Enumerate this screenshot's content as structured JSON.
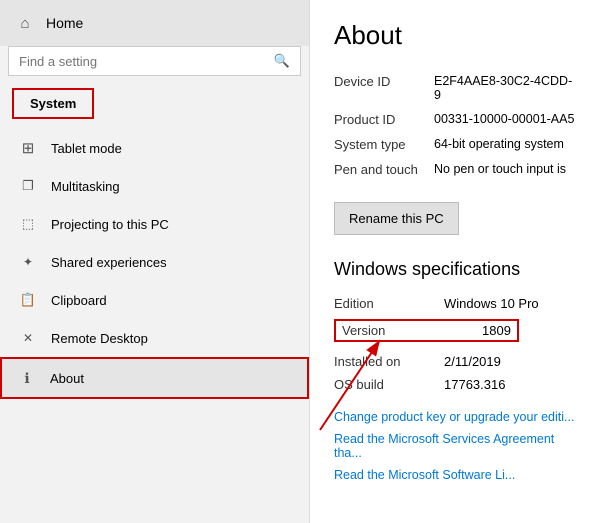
{
  "sidebar": {
    "home_label": "Home",
    "search_placeholder": "Find a setting",
    "system_label": "System",
    "nav_items": [
      {
        "id": "tablet-mode",
        "icon": "⊞",
        "label": "Tablet mode"
      },
      {
        "id": "multitasking",
        "icon": "❐",
        "label": "Multitasking"
      },
      {
        "id": "projecting",
        "icon": "⬚",
        "label": "Projecting to this PC"
      },
      {
        "id": "shared",
        "icon": "✕",
        "label": "Shared experiences"
      },
      {
        "id": "clipboard",
        "icon": "📋",
        "label": "Clipboard"
      },
      {
        "id": "remote",
        "icon": "✕",
        "label": "Remote Desktop"
      },
      {
        "id": "about",
        "icon": "ℹ",
        "label": "About",
        "active": true
      }
    ]
  },
  "main": {
    "title": "About",
    "device_id_label": "Device ID",
    "device_id_value": "E2F4AAE8-30C2-4CDD-9",
    "product_id_label": "Product ID",
    "product_id_value": "00331-10000-00001-AA5",
    "system_type_label": "System type",
    "system_type_value": "64-bit operating system",
    "pen_touch_label": "Pen and touch",
    "pen_touch_value": "No pen or touch input is",
    "rename_btn_label": "Rename this PC",
    "specs_title": "Windows specifications",
    "edition_label": "Edition",
    "edition_value": "Windows 10 Pro",
    "version_label": "Version",
    "version_value": "1809",
    "installed_label": "Installed on",
    "installed_value": "2/11/2019",
    "os_build_label": "OS build",
    "os_build_value": "17763.316",
    "link1": "Change product key or upgrade your editi...",
    "link2": "Read the Microsoft Services Agreement tha...",
    "link3": "Read the Microsoft Software Li..."
  }
}
